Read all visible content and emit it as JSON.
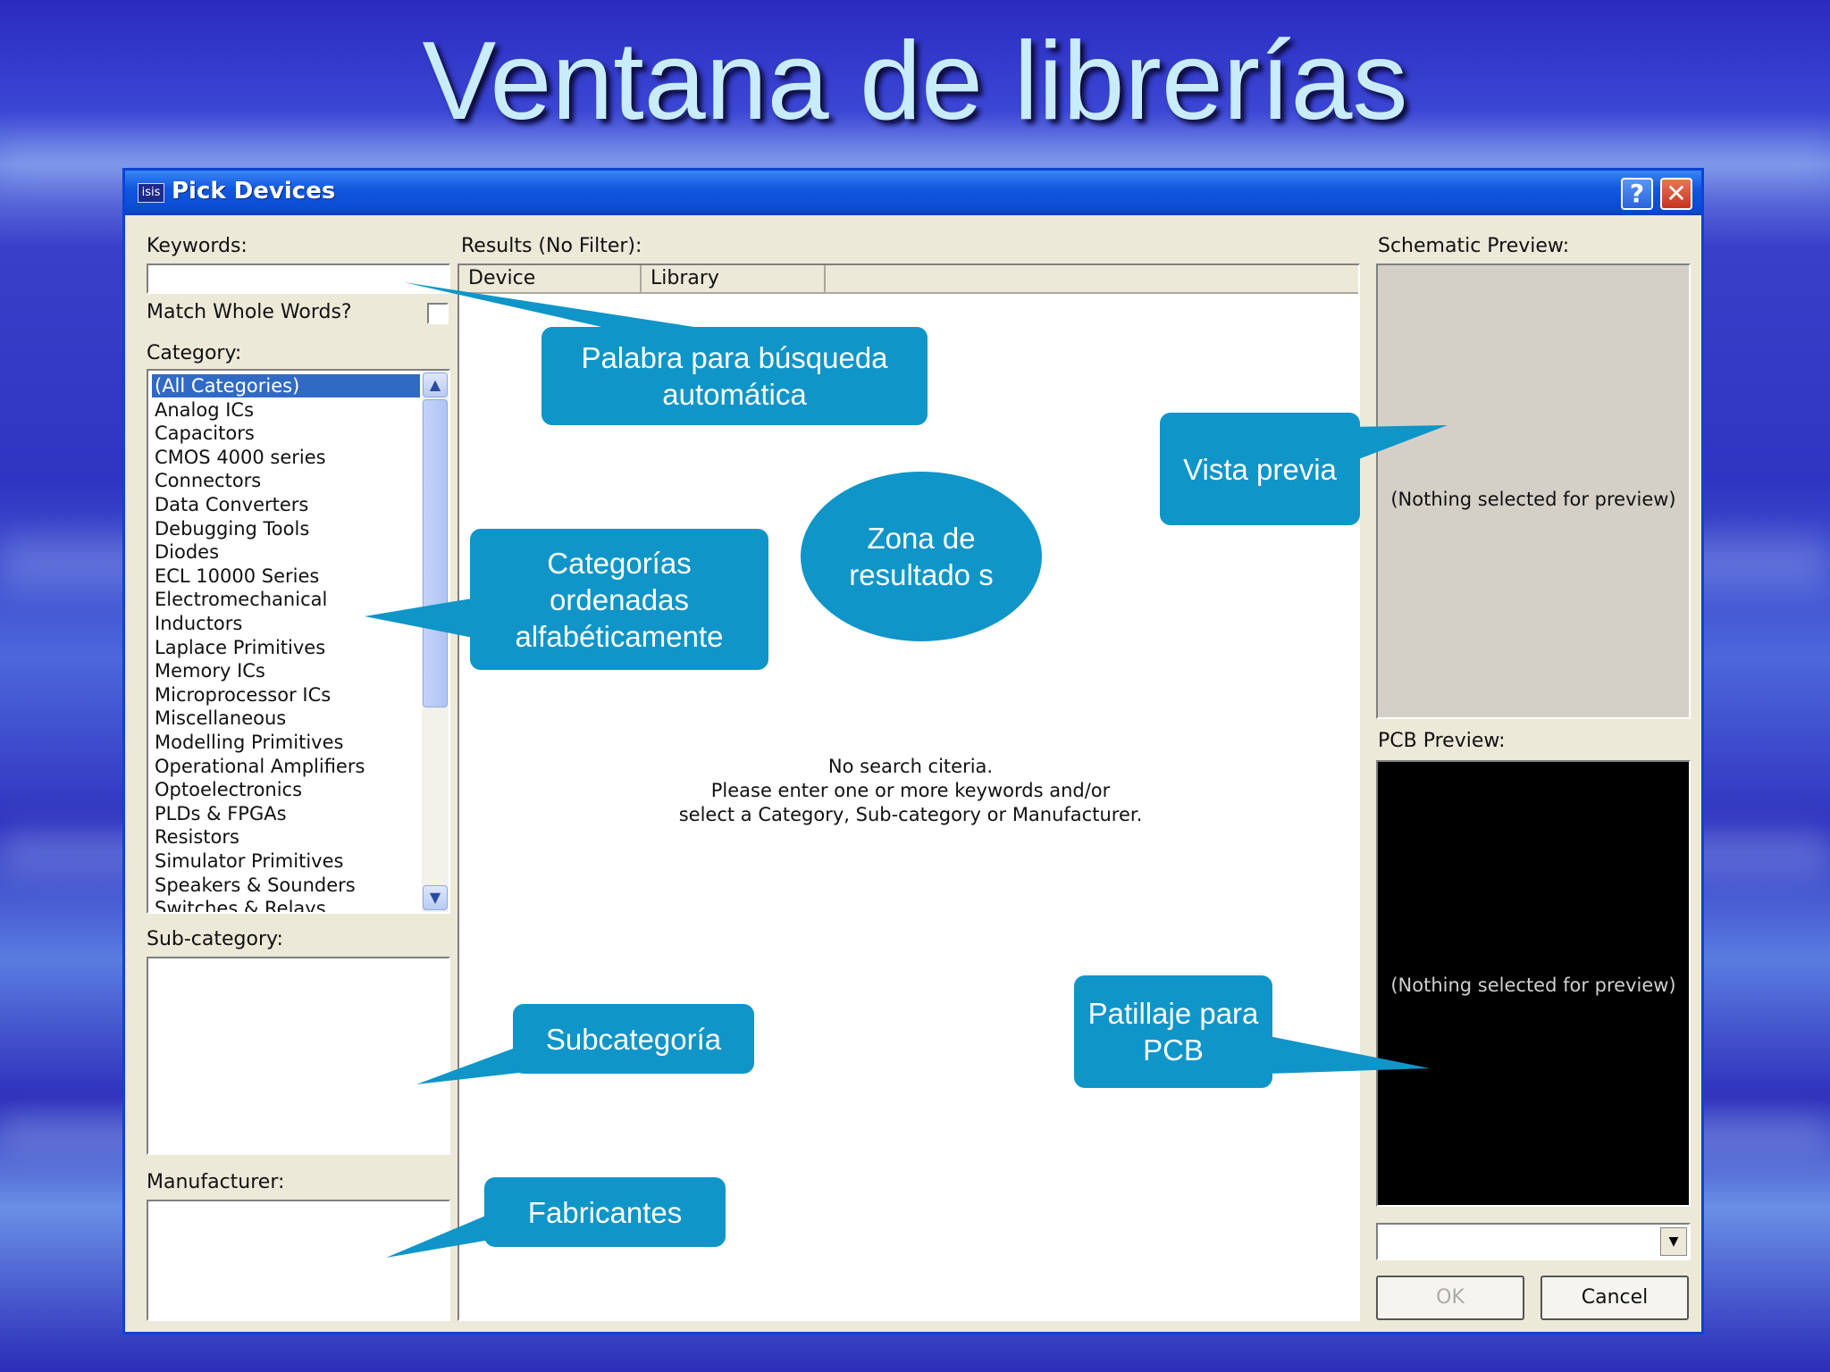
{
  "slide": {
    "title": "Ventana de librerías"
  },
  "window": {
    "icon_text": "isis",
    "title": "Pick Devices",
    "help": "?",
    "close": "✕"
  },
  "left": {
    "keywords_label": "Keywords:",
    "keywords_value": "",
    "match_label": "Match Whole Words?",
    "match_checked": false,
    "category_label": "Category:",
    "categories": [
      "(All Categories)",
      "Analog ICs",
      "Capacitors",
      "CMOS 4000 series",
      "Connectors",
      "Data Converters",
      "Debugging Tools",
      "Diodes",
      "ECL 10000 Series",
      "Electromechanical",
      "Inductors",
      "Laplace Primitives",
      "Memory ICs",
      "Microprocessor ICs",
      "Miscellaneous",
      "Modelling Primitives",
      "Operational Amplifiers",
      "Optoelectronics",
      "PLDs & FPGAs",
      "Resistors",
      "Simulator Primitives",
      "Speakers & Sounders",
      "Switches & Relays"
    ],
    "selected_category": "(All Categories)",
    "subcategory_label": "Sub-category:",
    "manufacturer_label": "Manufacturer:"
  },
  "results": {
    "label": "Results (No Filter):",
    "columns": [
      "Device",
      "Library"
    ],
    "empty_message": "No search citeria.\nPlease enter one or more keywords and/or\nselect a Category, Sub-category or Manufacturer."
  },
  "preview": {
    "schematic_label": "Schematic Preview:",
    "schematic_text": "(Nothing selected for preview)",
    "pcb_label": "PCB Preview:",
    "pcb_text": "(Nothing selected for preview)",
    "package_value": ""
  },
  "buttons": {
    "ok": "OK",
    "cancel": "Cancel"
  },
  "callouts": {
    "keyword": "Palabra para búsqueda automática",
    "categories": "Categorías ordenadas alfabéticamente",
    "results_zone": "Zona de resultado s",
    "preview": "Vista previa",
    "subcategory": "Subcategoría",
    "manufacturers": "Fabricantes",
    "pcb": "Patillaje para PCB"
  },
  "colors": {
    "callout": "#0f95c8",
    "selection": "#316ac5",
    "title_text": "#c9ecfb"
  }
}
